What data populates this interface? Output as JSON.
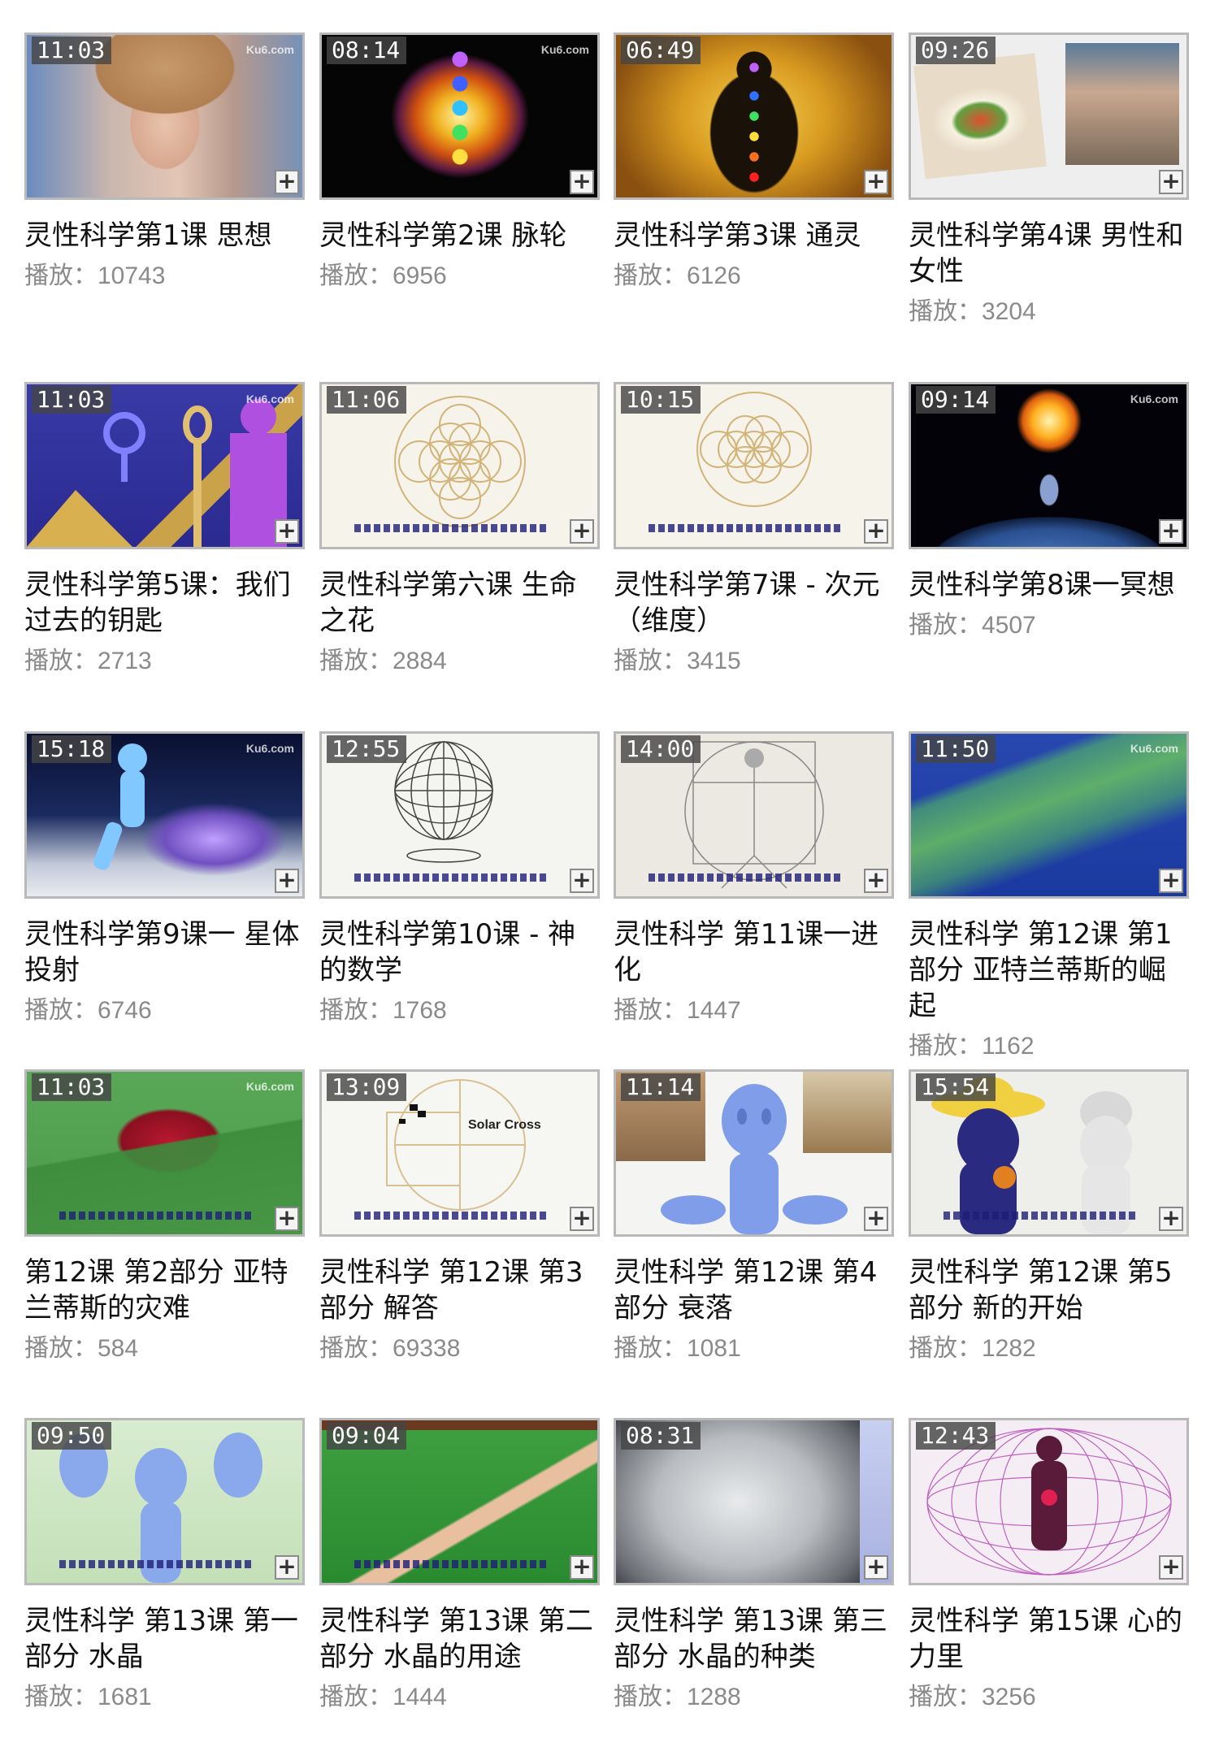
{
  "plays_label": "播放：",
  "watermark": "Ku6.com",
  "videos": [
    {
      "duration": "11:03",
      "title": "灵性科学第1课 思想",
      "plays": "10743"
    },
    {
      "duration": "08:14",
      "title": "灵性科学第2课 脉轮",
      "plays": "6956"
    },
    {
      "duration": "06:49",
      "title": "灵性科学第3课 通灵",
      "plays": "6126"
    },
    {
      "duration": "09:26",
      "title": "灵性科学第4课 男性和女性",
      "plays": "3204"
    },
    {
      "duration": "11:03",
      "title": "灵性科学第5课：我们过去的钥匙",
      "plays": "2713"
    },
    {
      "duration": "11:06",
      "title": "灵性科学第六课 生命之花",
      "plays": "2884"
    },
    {
      "duration": "10:15",
      "title": "灵性科学第7课 - 次元（维度）",
      "plays": "3415"
    },
    {
      "duration": "09:14",
      "title": "灵性科学第8课一冥想",
      "plays": "4507"
    },
    {
      "duration": "15:18",
      "title": "灵性科学第9课一 星体投射",
      "plays": "6746"
    },
    {
      "duration": "12:55",
      "title": "灵性科学第10课 - 神的数学",
      "plays": "1768"
    },
    {
      "duration": "14:00",
      "title": "灵性科学 第11课一进化",
      "plays": "1447"
    },
    {
      "duration": "11:50",
      "title": "灵性科学 第12课 第1部分 亚特兰蒂斯的崛起",
      "plays": "1162"
    },
    {
      "duration": "11:03",
      "title": "第12课 第2部分 亚特兰蒂斯的灾难",
      "plays": "584"
    },
    {
      "duration": "13:09",
      "title": "灵性科学 第12课 第3部分 解答",
      "plays": "69338"
    },
    {
      "duration": "11:14",
      "title": "灵性科学 第12课 第4部分 衰落",
      "plays": "1081"
    },
    {
      "duration": "15:54",
      "title": "灵性科学 第12课 第5部分 新的开始",
      "plays": "1282"
    },
    {
      "duration": "09:50",
      "title": "灵性科学 第13课 第一部分 水晶",
      "plays": "1681"
    },
    {
      "duration": "09:04",
      "title": "灵性科学 第13课 第二部分 水晶的用途",
      "plays": "1444"
    },
    {
      "duration": "08:31",
      "title": "灵性科学 第13课 第三部分 水晶的种类",
      "plays": "1288"
    },
    {
      "duration": "12:43",
      "title": "灵性科学 第15课 心的力里",
      "plays": "3256"
    }
  ],
  "thumb_labels": {
    "solar_cross": "Solar Cross"
  },
  "colors": {
    "plays_text": "#8a8a8a",
    "title_text": "#111111",
    "thumb_border": "#b9b9b9"
  }
}
